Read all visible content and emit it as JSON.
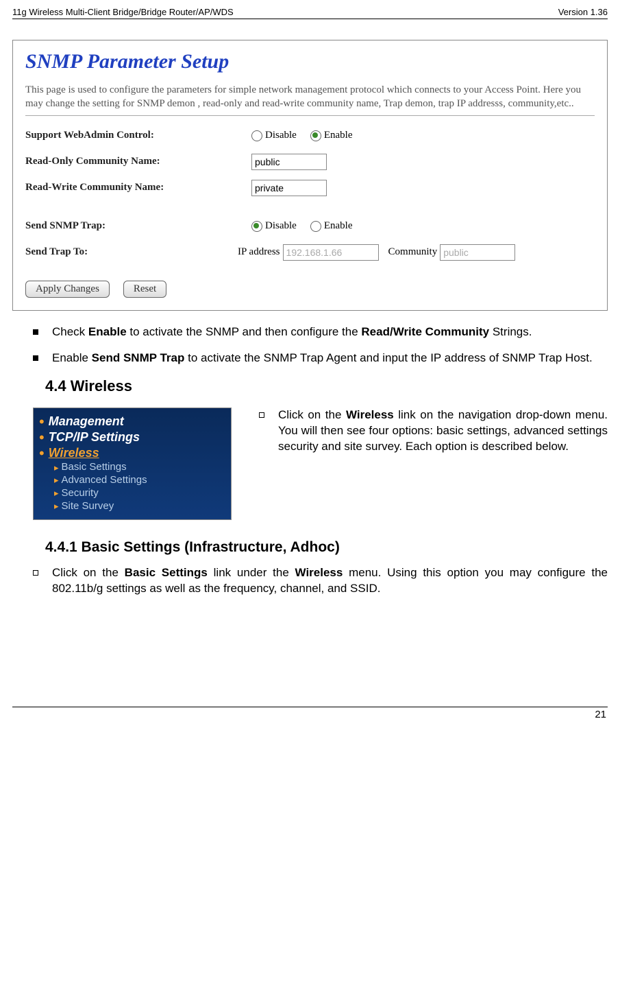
{
  "header": {
    "left": "11g Wireless Multi-Client Bridge/Bridge Router/AP/WDS",
    "right": "Version 1.36"
  },
  "snmp": {
    "title": "SNMP Parameter Setup",
    "desc": "This page is used to configure the parameters for simple network management protocol which connects to your Access Point. Here you may change the setting for SNMP demon , read-only and read-write community name, Trap demon, trap IP addresss, community,etc..",
    "labels": {
      "webadmin": "Support WebAdmin Control:",
      "readonly_name": "Read-Only Community Name:",
      "readwrite_name": "Read-Write Community Name:",
      "send_trap": "Send SNMP Trap:",
      "send_trap_to": "Send Trap To:",
      "ip_address": "IP address",
      "community": "Community"
    },
    "options": {
      "disable": "Disable",
      "enable": "Enable"
    },
    "values": {
      "readonly": "public",
      "readwrite": "private",
      "trap_ip": "192.168.1.66",
      "trap_community": "public"
    },
    "buttons": {
      "apply": "Apply Changes",
      "reset": "Reset"
    }
  },
  "bullets": {
    "b1_pre": "Check ",
    "b1_bold1": "Enable",
    "b1_mid": " to activate the SNMP and then configure the ",
    "b1_bold2": "Read/Write Community",
    "b1_post": " Strings.",
    "b2_pre": "Enable ",
    "b2_bold": "Send SNMP Trap",
    "b2_post": " to activate the SNMP Trap Agent and input the IP address of SNMP Trap Host."
  },
  "section44": {
    "heading": "4.4   Wireless",
    "nav": {
      "items": [
        "Management",
        "TCP/IP Settings",
        "Wireless"
      ],
      "subitems": [
        "Basic Settings",
        "Advanced Settings",
        "Security",
        "Site Survey"
      ]
    },
    "desc_pre": "Click on the ",
    "desc_bold": "Wireless",
    "desc_post": " link on the navigation drop-down menu. You will then see four options: basic settings, advanced settings security and site survey. Each option is described below."
  },
  "section441": {
    "heading": "4.4.1  Basic Settings (Infrastructure, Adhoc)",
    "b_pre": "Click on the  ",
    "b_bold1": "Basic Settings",
    "b_mid": " link under the ",
    "b_bold2": "Wireless",
    "b_post": " menu. Using this option you may configure the 802.11b/g settings as well as the frequency, channel, and SSID."
  },
  "footer": {
    "page": "21"
  }
}
